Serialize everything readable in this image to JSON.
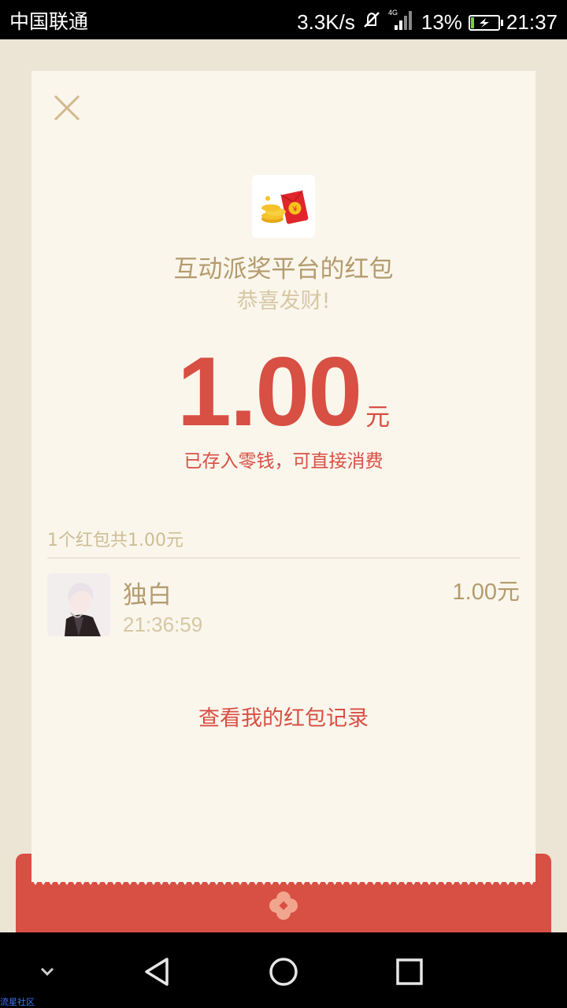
{
  "status_bar": {
    "carrier": "中国联通",
    "net_speed": "3.3K/s",
    "network_type": "4G",
    "battery_percent": "13%",
    "battery_level": 0.13,
    "time": "21:37",
    "icons": [
      "mute-icon",
      "signal-icon",
      "battery-charging-icon"
    ]
  },
  "card": {
    "close_icon": "close-icon",
    "logo_icon": "red-envelope-coins-icon",
    "sender_title": "互动派奖平台的红包",
    "greeting": "恭喜发财!",
    "amount": "1.00",
    "amount_unit": "元",
    "saved_note": "已存入零钱，可直接消费",
    "summary": "1个红包共1.00元",
    "records": [
      {
        "name": "独白",
        "time": "21:36:59",
        "amount": "1.00元"
      }
    ],
    "history_link": "查看我的红包记录"
  },
  "colors": {
    "accent_red": "#d84f44",
    "gold_text": "#b49b6d",
    "light_gold": "#d6c7a4",
    "card_bg": "#faf6ec",
    "page_bg": "#ece5d6"
  },
  "nav_bar": {
    "icons": [
      "collapse-icon",
      "back-icon",
      "home-icon",
      "recents-icon"
    ],
    "watermark": "流星社区"
  }
}
